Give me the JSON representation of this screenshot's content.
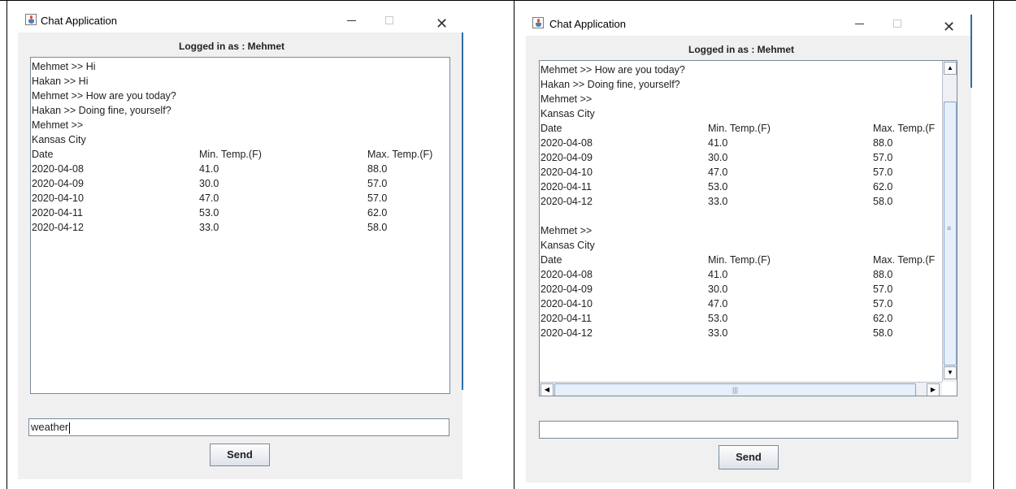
{
  "window_title": "Chat Application",
  "icons": {
    "app": "java-cup-icon",
    "minimize": "minimize-icon",
    "maximize": "maximize-icon",
    "close": "close-icon"
  },
  "window_buttons": {
    "minimize": "—",
    "close": "✕"
  },
  "left": {
    "logged_in": "Logged in as : Mehmet",
    "messages": [
      "Mehmet >> Hi",
      "Hakan >> Hi",
      "Mehmet >> How are you today?",
      "Hakan >> Doing fine, yourself?",
      "Mehmet >>",
      "Kansas City"
    ],
    "weather_header": [
      "Date",
      "Min. Temp.(F)",
      "Max. Temp.(F)"
    ],
    "weather_rows": [
      [
        "2020-04-08",
        "41.0",
        "88.0"
      ],
      [
        "2020-04-09",
        "30.0",
        "57.0"
      ],
      [
        "2020-04-10",
        "47.0",
        "57.0"
      ],
      [
        "2020-04-11",
        "53.0",
        "62.0"
      ],
      [
        "2020-04-12",
        "33.0",
        "58.0"
      ]
    ],
    "input_value": "weather",
    "send_label": "Send"
  },
  "right": {
    "logged_in": "Logged in as : Mehmet",
    "messages": [
      "Mehmet >> How are you today?",
      "Hakan >> Doing fine, yourself?",
      "Mehmet >>",
      "Kansas City"
    ],
    "weather_header": [
      "Date",
      "Min. Temp.(F)",
      "Max. Temp.(F"
    ],
    "weather_rows": [
      [
        "2020-04-08",
        "41.0",
        "88.0"
      ],
      [
        "2020-04-09",
        "30.0",
        "57.0"
      ],
      [
        "2020-04-10",
        "47.0",
        "57.0"
      ],
      [
        "2020-04-11",
        "53.0",
        "62.0"
      ],
      [
        "2020-04-12",
        "33.0",
        "58.0"
      ]
    ],
    "messages_2": [
      "Mehmet >>",
      "Kansas City"
    ],
    "weather_header_2": [
      "Date",
      "Min. Temp.(F)",
      "Max. Temp.(F"
    ],
    "weather_rows_2": [
      [
        "2020-04-08",
        "41.0",
        "88.0"
      ],
      [
        "2020-04-09",
        "30.0",
        "57.0"
      ],
      [
        "2020-04-10",
        "47.0",
        "57.0"
      ],
      [
        "2020-04-11",
        "53.0",
        "62.0"
      ],
      [
        "2020-04-12",
        "33.0",
        "58.0"
      ]
    ],
    "input_value": "",
    "send_label": "Send"
  },
  "scrollbar": {
    "up": "▲",
    "down": "▼",
    "left": "◀",
    "right": "▶",
    "grip_v": "≡",
    "grip_h": "|||"
  }
}
